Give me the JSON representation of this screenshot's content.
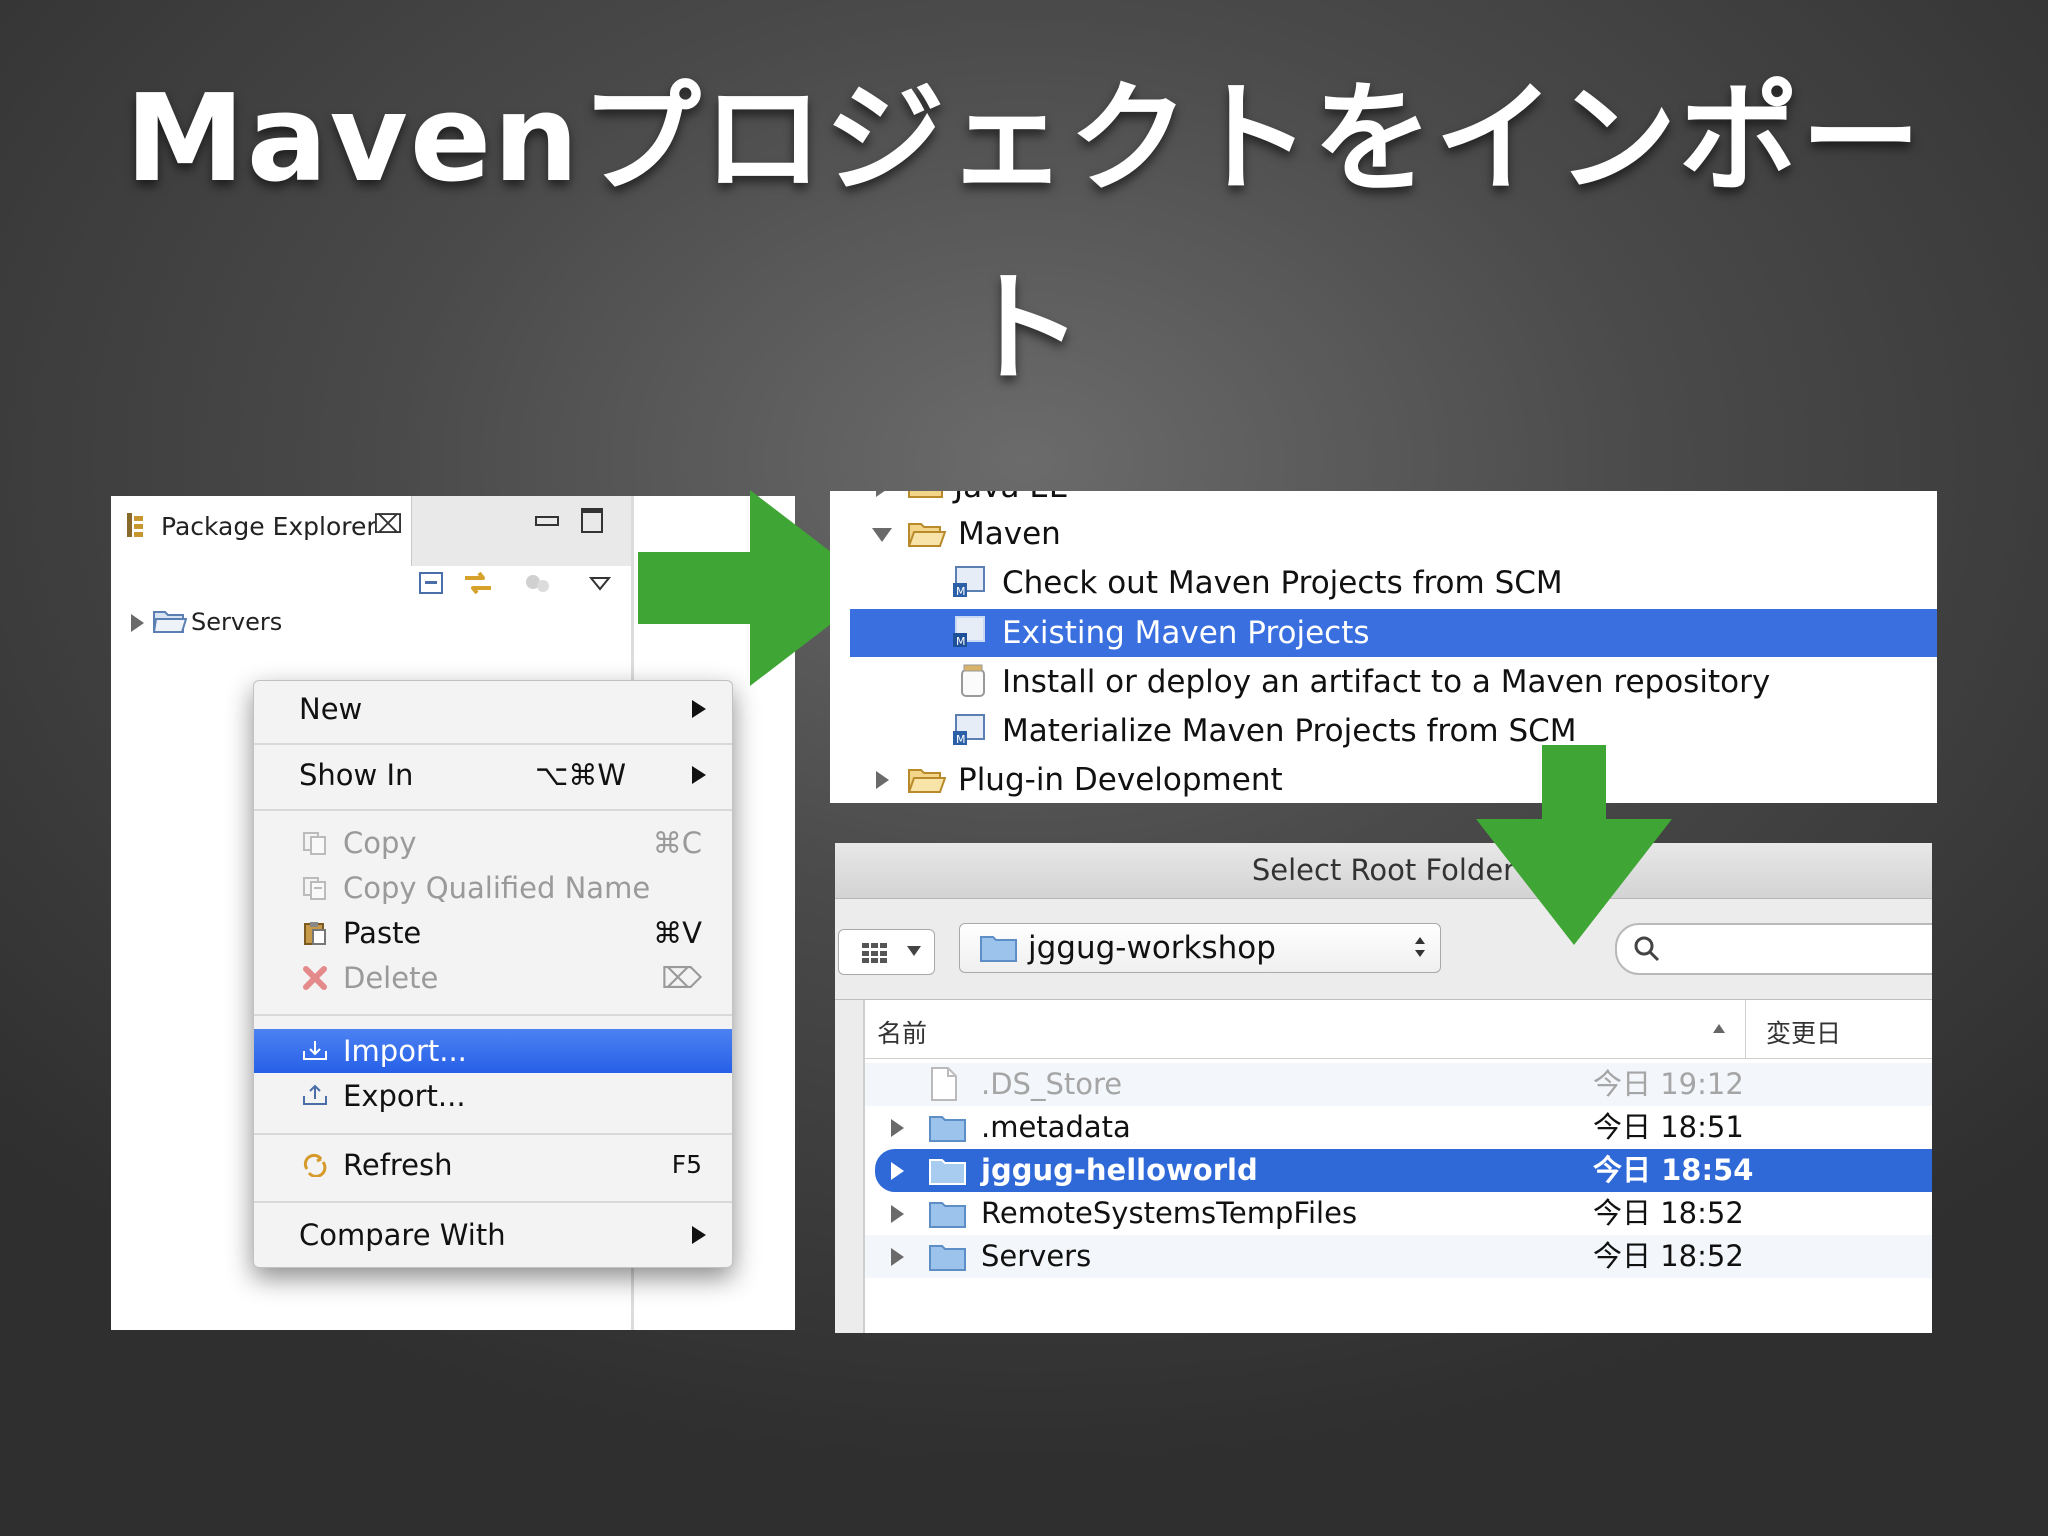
{
  "slide": {
    "title_line1": "Mavenプロジェクトをインポー",
    "title_line2": "ト"
  },
  "package_explorer": {
    "tab_label": "Package Explorer",
    "close_glyph": "⌧",
    "tree": [
      {
        "label": "Servers"
      }
    ]
  },
  "context_menu": {
    "items": {
      "new": "New",
      "show_in": "Show In",
      "show_in_shortcut": "⌥⌘W",
      "copy": "Copy",
      "copy_shortcut": "⌘C",
      "copy_qualified": "Copy Qualified Name",
      "paste": "Paste",
      "paste_shortcut": "⌘V",
      "delete": "Delete",
      "delete_shortcut": "⌦",
      "import": "Import...",
      "export": "Export...",
      "refresh": "Refresh",
      "refresh_shortcut": "F5",
      "compare_with": "Compare With"
    }
  },
  "import_wizard": {
    "partial_top": "Java EE",
    "maven_folder": "Maven",
    "items": [
      "Check out Maven Projects from SCM",
      "Existing Maven Projects",
      "Install or deploy an artifact to a Maven repository",
      "Materialize Maven Projects from SCM"
    ],
    "plugin_folder": "Plug-in Development"
  },
  "root_folder_dialog": {
    "title": "Select Root Folder",
    "location": "jggug-workshop",
    "header_name": "名前",
    "header_date": "変更日",
    "files": [
      {
        "name": ".DS_Store",
        "date": "今日 19:12"
      },
      {
        "name": ".metadata",
        "date": "今日 18:51"
      },
      {
        "name": "jggug-helloworld",
        "date": "今日 18:54"
      },
      {
        "name": "RemoteSystemsTempFiles",
        "date": "今日 18:52"
      },
      {
        "name": "Servers",
        "date": "今日 18:52"
      }
    ]
  },
  "colors": {
    "selection_blue": "#3a6fe0",
    "arrow_green": "#3fa535"
  }
}
